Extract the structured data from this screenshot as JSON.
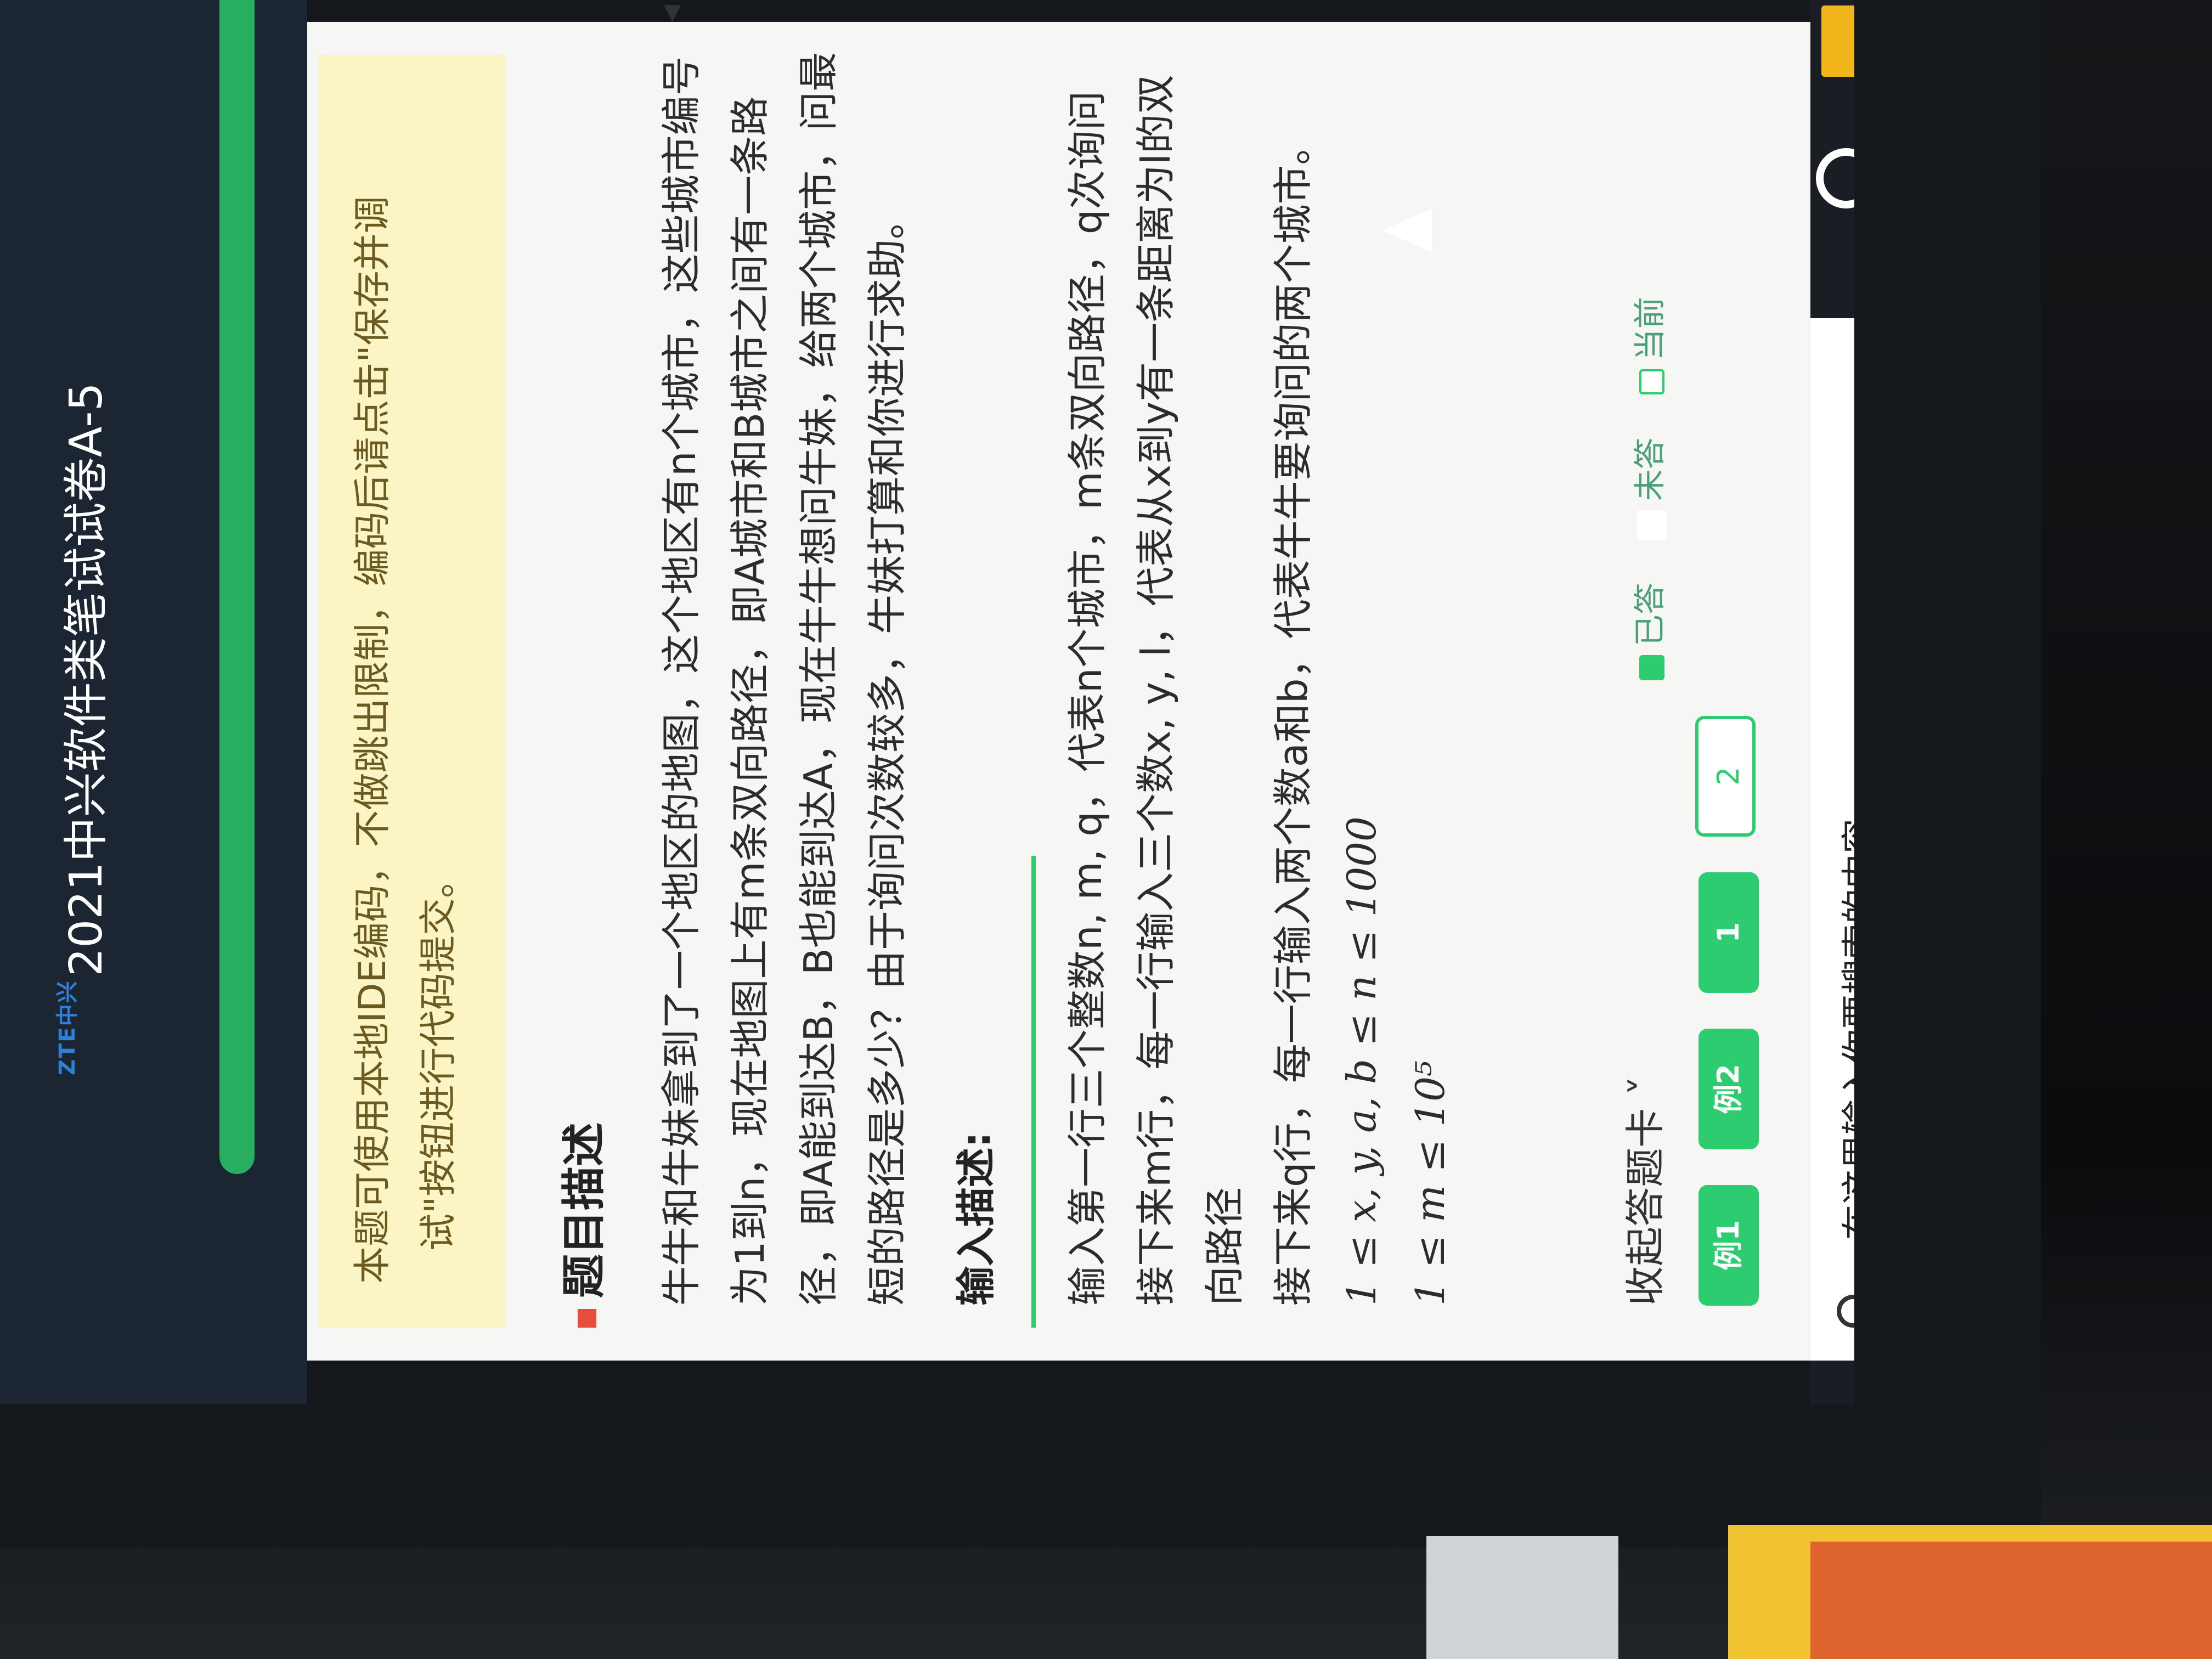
{
  "header": {
    "logo": "ZTE中兴",
    "title": "2021中兴软件类笔试试卷A-5"
  },
  "notice": {
    "line1": "本题可使用本地IDE编码，不做跳出限制，编码后请点击\"保存并调",
    "line2": "试\"按钮进行代码提交。"
  },
  "problem": {
    "section_title": "题目描述",
    "para1": "牛牛和牛妹拿到了一个地区的地图，这个地区有n个城市，这些城市编号为1到n，现在地图上有m条双向路径，即A城市和B城市之间有一条路径，即A能到达B，B也能到达A，现在牛牛想问牛妹，给两个城市，问最短的路径是多少？由于询问次数较多，牛妹打算和你进行求助。",
    "input_title": "输入描述:",
    "input_line1": "输入第一行三个整数n, m, q，代表n个城市，m条双向路径，q次询问",
    "input_line2": "接下来m行，每一行输入三个数x, y, l，代表从x到y有一条距离为l的双向路径",
    "input_line3": "接下来q行，每一行输入两个数a和b，代表牛牛要询问的两个城市。",
    "constraint1": "1 ≤ x, y, a, b ≤ n ≤ 1000",
    "constraint2": "1 ≤ m ≤ 10⁵"
  },
  "footer": {
    "collapse_label": "收起答题卡 ˅",
    "legend_done": "已答",
    "legend_not": "未答",
    "legend_current": "当前",
    "chips": [
      "例1",
      "例2",
      "1",
      "2"
    ]
  },
  "taskbar": {
    "search_placeholder": "在这里输入你要搜索的内容"
  },
  "colors": {
    "accent_green": "#2ecc71",
    "header_bg": "#1c2633",
    "notice_bg": "#fbf5c6",
    "bullet_red": "#e74c3c"
  }
}
